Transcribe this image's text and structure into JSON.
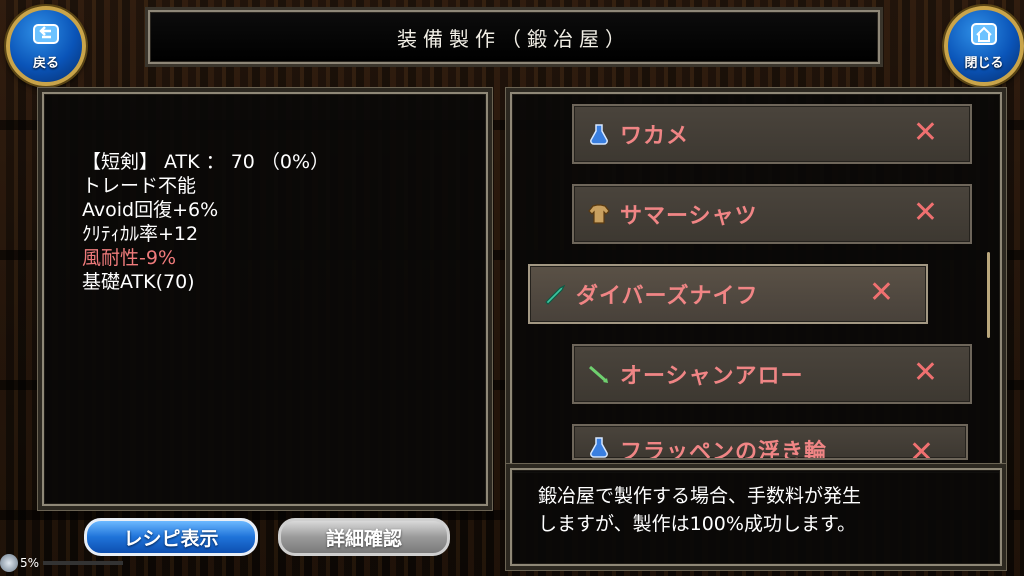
{
  "header": {
    "title": "装備製作（鍛冶屋）",
    "back_label": "戻る",
    "close_label": "閉じる"
  },
  "item_details": {
    "lines": [
      {
        "text": "【短剣】 ATK ： 70 （0%）",
        "color": "#ffffff"
      },
      {
        "text": "トレード不能",
        "color": "#ffffff"
      },
      {
        "text": "Avoid回復+6%",
        "color": "#ffffff"
      },
      {
        "text": "ｸﾘﾃｨｶﾙ率+12",
        "color": "#ffffff"
      },
      {
        "text": "風耐性-9%",
        "color": "#ef7b7b"
      },
      {
        "text": "基礎ATK(70)",
        "color": "#ffffff"
      }
    ]
  },
  "recipe_list": {
    "items": [
      {
        "name": "ワカメ",
        "icon": "blue-flask-icon",
        "mark": "✕"
      },
      {
        "name": "サマーシャツ",
        "icon": "shirt-icon",
        "mark": "✕"
      },
      {
        "name": "ダイバーズナイフ",
        "icon": "knife-icon",
        "mark": "✕",
        "selected": true
      },
      {
        "name": "オーシャンアロー",
        "icon": "arrow-icon",
        "mark": "✕"
      },
      {
        "name": "フラッペンの浮き輪",
        "icon": "blue-flask-icon",
        "mark": "✕"
      }
    ]
  },
  "message": {
    "line1": "鍛冶屋で製作する場合、手数料が発生",
    "line2": "しますが、製作は100%成功します。"
  },
  "buttons": {
    "recipe_label": "レシピ表示",
    "detail_label": "詳細確認"
  },
  "status": {
    "progress_text": "5%",
    "progress_fraction": 0.05
  },
  "colors": {
    "accent_blue": "#1f73d9",
    "item_red": "#f08585",
    "gold": "#c9a44a"
  }
}
